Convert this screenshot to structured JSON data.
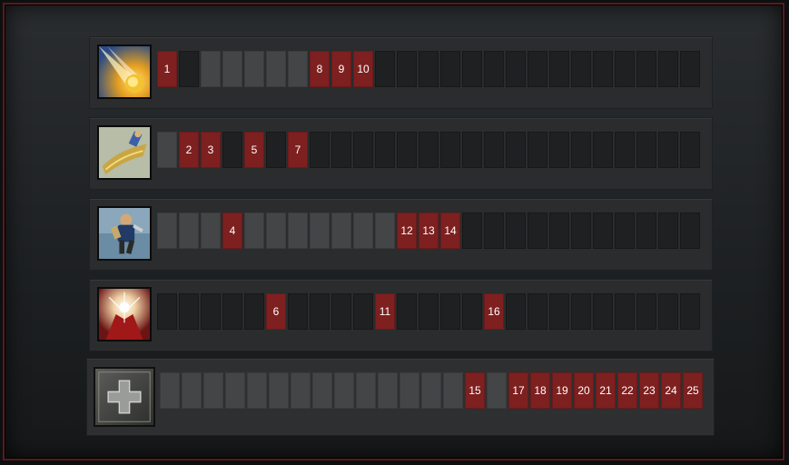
{
  "colors": {
    "empty": "#1f2021",
    "filled": "#444546",
    "level": "#7e2020"
  },
  "skills": [
    {
      "name": "Fiery Comet",
      "icon": "fiery-comet-icon",
      "slots": [
        {
          "state": "level",
          "label": "1"
        },
        {
          "state": "empty",
          "label": ""
        },
        {
          "state": "filled",
          "label": ""
        },
        {
          "state": "filled",
          "label": ""
        },
        {
          "state": "filled",
          "label": ""
        },
        {
          "state": "filled",
          "label": ""
        },
        {
          "state": "filled",
          "label": ""
        },
        {
          "state": "level",
          "label": "8"
        },
        {
          "state": "level",
          "label": "9"
        },
        {
          "state": "level",
          "label": "10"
        },
        {
          "state": "empty",
          "label": ""
        },
        {
          "state": "empty",
          "label": ""
        },
        {
          "state": "empty",
          "label": ""
        },
        {
          "state": "empty",
          "label": ""
        },
        {
          "state": "empty",
          "label": ""
        },
        {
          "state": "empty",
          "label": ""
        },
        {
          "state": "empty",
          "label": ""
        },
        {
          "state": "empty",
          "label": ""
        },
        {
          "state": "empty",
          "label": ""
        },
        {
          "state": "empty",
          "label": ""
        },
        {
          "state": "empty",
          "label": ""
        },
        {
          "state": "empty",
          "label": ""
        },
        {
          "state": "empty",
          "label": ""
        },
        {
          "state": "empty",
          "label": ""
        },
        {
          "state": "empty",
          "label": ""
        }
      ]
    },
    {
      "name": "Golden Cleave",
      "icon": "golden-cleave-icon",
      "slots": [
        {
          "state": "filled",
          "label": ""
        },
        {
          "state": "level",
          "label": "2"
        },
        {
          "state": "level",
          "label": "3"
        },
        {
          "state": "empty",
          "label": ""
        },
        {
          "state": "level",
          "label": "5"
        },
        {
          "state": "empty",
          "label": ""
        },
        {
          "state": "level",
          "label": "7"
        },
        {
          "state": "empty",
          "label": ""
        },
        {
          "state": "empty",
          "label": ""
        },
        {
          "state": "empty",
          "label": ""
        },
        {
          "state": "empty",
          "label": ""
        },
        {
          "state": "empty",
          "label": ""
        },
        {
          "state": "empty",
          "label": ""
        },
        {
          "state": "empty",
          "label": ""
        },
        {
          "state": "empty",
          "label": ""
        },
        {
          "state": "empty",
          "label": ""
        },
        {
          "state": "empty",
          "label": ""
        },
        {
          "state": "empty",
          "label": ""
        },
        {
          "state": "empty",
          "label": ""
        },
        {
          "state": "empty",
          "label": ""
        },
        {
          "state": "empty",
          "label": ""
        },
        {
          "state": "empty",
          "label": ""
        },
        {
          "state": "empty",
          "label": ""
        },
        {
          "state": "empty",
          "label": ""
        },
        {
          "state": "empty",
          "label": ""
        }
      ]
    },
    {
      "name": "Warrior Rush",
      "icon": "warrior-rush-icon",
      "slots": [
        {
          "state": "filled",
          "label": ""
        },
        {
          "state": "filled",
          "label": ""
        },
        {
          "state": "filled",
          "label": ""
        },
        {
          "state": "level",
          "label": "4"
        },
        {
          "state": "filled",
          "label": ""
        },
        {
          "state": "filled",
          "label": ""
        },
        {
          "state": "filled",
          "label": ""
        },
        {
          "state": "filled",
          "label": ""
        },
        {
          "state": "filled",
          "label": ""
        },
        {
          "state": "filled",
          "label": ""
        },
        {
          "state": "filled",
          "label": ""
        },
        {
          "state": "level",
          "label": "12"
        },
        {
          "state": "level",
          "label": "13"
        },
        {
          "state": "level",
          "label": "14"
        },
        {
          "state": "empty",
          "label": ""
        },
        {
          "state": "empty",
          "label": ""
        },
        {
          "state": "empty",
          "label": ""
        },
        {
          "state": "empty",
          "label": ""
        },
        {
          "state": "empty",
          "label": ""
        },
        {
          "state": "empty",
          "label": ""
        },
        {
          "state": "empty",
          "label": ""
        },
        {
          "state": "empty",
          "label": ""
        },
        {
          "state": "empty",
          "label": ""
        },
        {
          "state": "empty",
          "label": ""
        },
        {
          "state": "empty",
          "label": ""
        }
      ]
    },
    {
      "name": "Divine Blast",
      "icon": "divine-blast-icon",
      "slots": [
        {
          "state": "empty",
          "label": ""
        },
        {
          "state": "empty",
          "label": ""
        },
        {
          "state": "empty",
          "label": ""
        },
        {
          "state": "empty",
          "label": ""
        },
        {
          "state": "empty",
          "label": ""
        },
        {
          "state": "level",
          "label": "6"
        },
        {
          "state": "empty",
          "label": ""
        },
        {
          "state": "empty",
          "label": ""
        },
        {
          "state": "empty",
          "label": ""
        },
        {
          "state": "empty",
          "label": ""
        },
        {
          "state": "level",
          "label": "11"
        },
        {
          "state": "empty",
          "label": ""
        },
        {
          "state": "empty",
          "label": ""
        },
        {
          "state": "empty",
          "label": ""
        },
        {
          "state": "empty",
          "label": ""
        },
        {
          "state": "level",
          "label": "16"
        },
        {
          "state": "empty",
          "label": ""
        },
        {
          "state": "empty",
          "label": ""
        },
        {
          "state": "empty",
          "label": ""
        },
        {
          "state": "empty",
          "label": ""
        },
        {
          "state": "empty",
          "label": ""
        },
        {
          "state": "empty",
          "label": ""
        },
        {
          "state": "empty",
          "label": ""
        },
        {
          "state": "empty",
          "label": ""
        },
        {
          "state": "empty",
          "label": ""
        }
      ]
    }
  ],
  "stats": {
    "icon": "plus-icon",
    "slots": [
      {
        "state": "filled",
        "label": ""
      },
      {
        "state": "filled",
        "label": ""
      },
      {
        "state": "filled",
        "label": ""
      },
      {
        "state": "filled",
        "label": ""
      },
      {
        "state": "filled",
        "label": ""
      },
      {
        "state": "filled",
        "label": ""
      },
      {
        "state": "filled",
        "label": ""
      },
      {
        "state": "filled",
        "label": ""
      },
      {
        "state": "filled",
        "label": ""
      },
      {
        "state": "filled",
        "label": ""
      },
      {
        "state": "filled",
        "label": ""
      },
      {
        "state": "filled",
        "label": ""
      },
      {
        "state": "filled",
        "label": ""
      },
      {
        "state": "filled",
        "label": ""
      },
      {
        "state": "level",
        "label": "15"
      },
      {
        "state": "filled",
        "label": ""
      },
      {
        "state": "level",
        "label": "17"
      },
      {
        "state": "level",
        "label": "18"
      },
      {
        "state": "level",
        "label": "19"
      },
      {
        "state": "level",
        "label": "20"
      },
      {
        "state": "level",
        "label": "21"
      },
      {
        "state": "level",
        "label": "22"
      },
      {
        "state": "level",
        "label": "23"
      },
      {
        "state": "level",
        "label": "24"
      },
      {
        "state": "level",
        "label": "25"
      }
    ]
  }
}
